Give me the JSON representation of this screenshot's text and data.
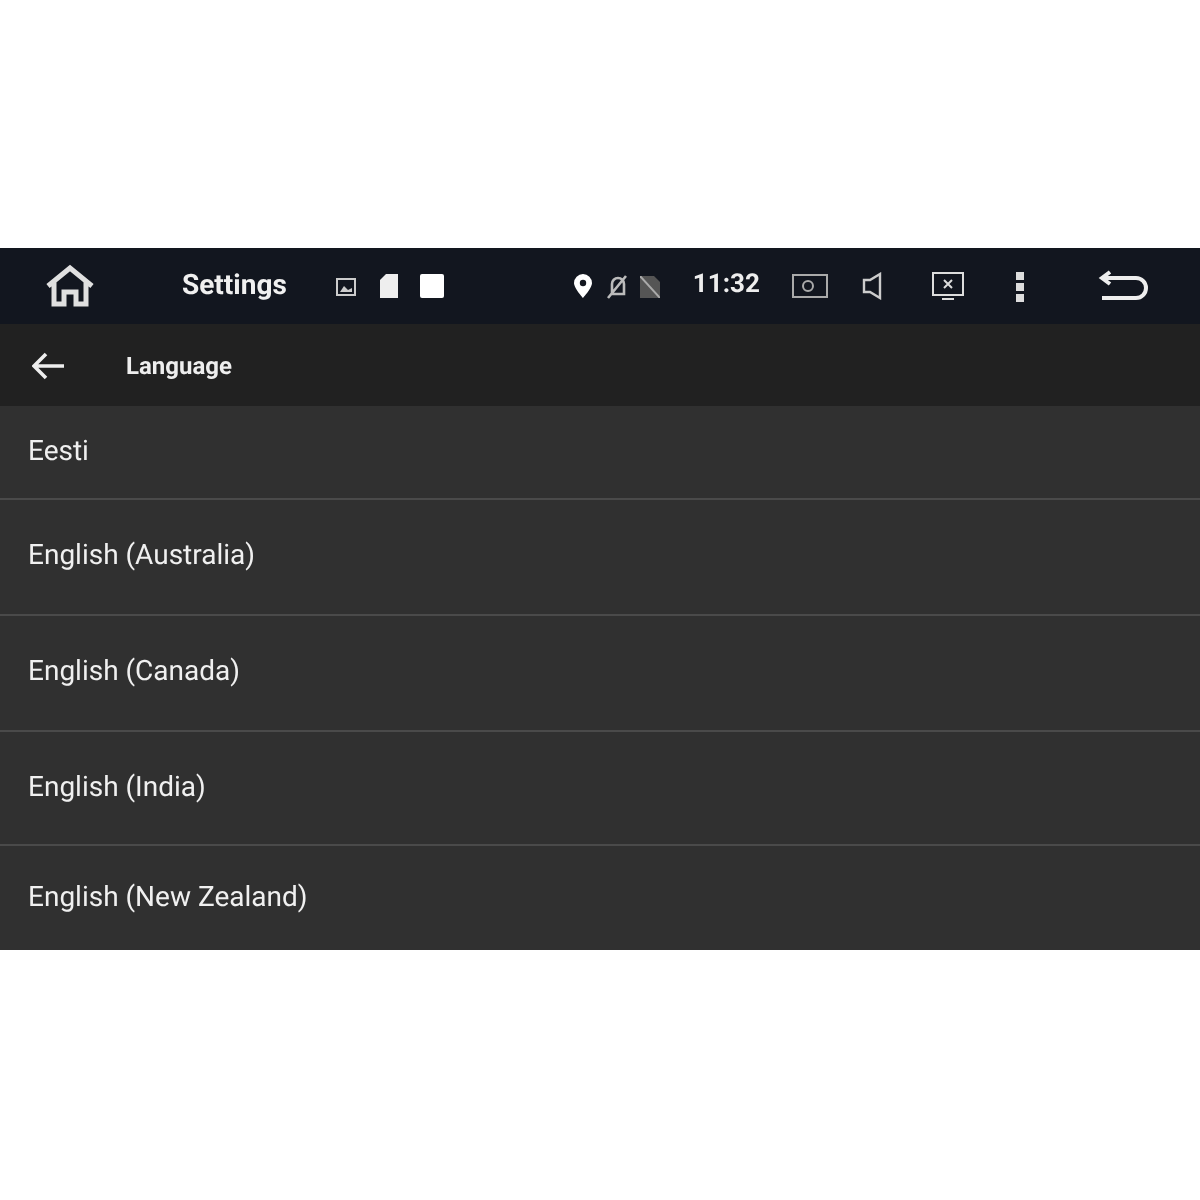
{
  "status_bar": {
    "title": "Settings",
    "time": "11:32"
  },
  "toolbar": {
    "title": "Language"
  },
  "languages": [
    {
      "label": "Eesti"
    },
    {
      "label": "English (Australia)"
    },
    {
      "label": "English (Canada)"
    },
    {
      "label": "English (India)"
    },
    {
      "label": "English (New Zealand)"
    }
  ]
}
